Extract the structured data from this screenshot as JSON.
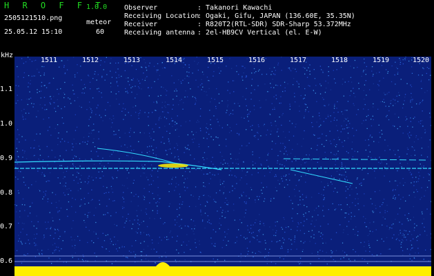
{
  "app": {
    "title": "H R O F F T",
    "version": "1.0.0"
  },
  "file": {
    "filename": "2505121510.png",
    "mode": "meteor",
    "datetime": "25.05.12 15:10",
    "count": "60"
  },
  "info": {
    "observer_label": "Observer",
    "observer_value": ": Takanori Kawachi",
    "location_label": "Receiving Location",
    "location_value": ": Ogaki, Gifu, JAPAN (136.60E, 35.35N)",
    "receiver_label": "Receiver",
    "receiver_value": ": R820T2(RTL-SDR) SDR-Sharp 53.372MHz",
    "antenna_label": "Receiving antenna",
    "antenna_value": ": 2el-HB9CV Vertical (el. E-W)"
  },
  "axes": {
    "y_unit": "kHz",
    "y_ticks": [
      "1.1",
      "1.0",
      "0.9",
      "0.8",
      "0.7",
      "0.6"
    ],
    "x_ticks": [
      "1511",
      "1512",
      "1513",
      "1514",
      "1515",
      "1516",
      "1517",
      "1518",
      "1519",
      "1520"
    ]
  },
  "colors": {
    "background": "#000000",
    "spectrogram_base": "#0a1f7a",
    "header_green": "#22dd22",
    "signal_cyan": "#33ddff",
    "signal_yellow": "#ffee00",
    "level_bar": "#ffee00"
  }
}
